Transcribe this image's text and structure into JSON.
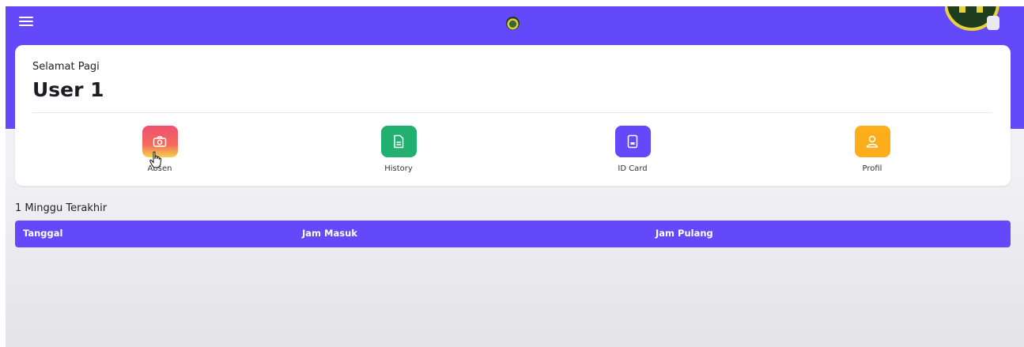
{
  "header": {
    "menu_icon": "hamburger-menu-icon",
    "logo_icon": "regional-emblem-icon",
    "avatar_icon": "user-avatar-emblem"
  },
  "greeting": {
    "salutation": "Selamat Pagi",
    "name": "User 1"
  },
  "menu": [
    {
      "label": "Absen",
      "icon": "camera-icon",
      "color": "#f0506e"
    },
    {
      "label": "History",
      "icon": "document-icon",
      "color": "#22b070"
    },
    {
      "label": "ID Card",
      "icon": "id-card-icon",
      "color": "#6449fa"
    },
    {
      "label": "Profil",
      "icon": "user-icon",
      "color": "#ffae1b"
    }
  ],
  "recent": {
    "title": "1 Minggu Terakhir",
    "columns": [
      "Tanggal",
      "Jam Masuk",
      "Jam Pulang"
    ]
  },
  "colors": {
    "primary": "#6449fa",
    "background": "#f2f2f6",
    "card": "#ffffff"
  }
}
